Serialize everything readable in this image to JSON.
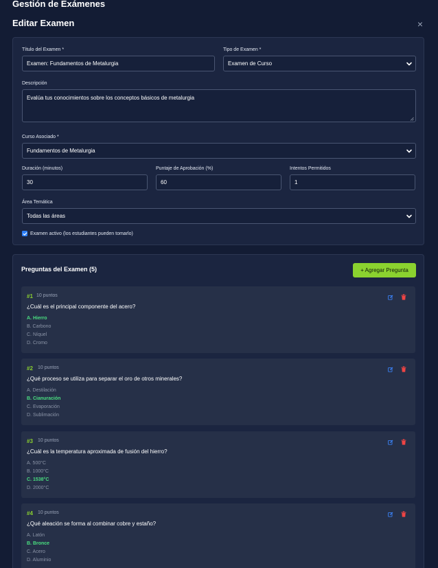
{
  "page": {
    "title": "Gestión de Exámenes"
  },
  "modal": {
    "title": "Editar Examen",
    "close_symbol": "×"
  },
  "form": {
    "title_label": "Título del Examen *",
    "title_value": "Examen: Fundamentos de Metalurgia",
    "type_label": "Tipo de Examen *",
    "type_value": "Examen de Curso",
    "description_label": "Descripción",
    "description_value": "Evalúa tus conocimientos sobre los conceptos básicos de metalurgia",
    "course_label": "Curso Asociado *",
    "course_value": "Fundamentos de Metalurgia",
    "duration_label": "Duración (minutos)",
    "duration_value": "30",
    "passing_label": "Puntaje de Aprobación (%)",
    "passing_value": "60",
    "attempts_label": "Intentos Permitidos",
    "attempts_value": "1",
    "area_label": "Área Temática",
    "area_value": "Todas las áreas",
    "active_label": "Examen activo (los estudiantes pueden tomarlo)",
    "active_checked": true
  },
  "questions_section": {
    "header": "Preguntas del Examen (5)",
    "add_button": "+ Agregar Pregunta",
    "questions": [
      {
        "number": "#1",
        "points": "10 puntos",
        "text": "¿Cuál es el principal componente del acero?",
        "options": [
          "A. Hierro",
          "B. Carbono",
          "C. Níquel",
          "D. Cromo"
        ],
        "correct_index": 0
      },
      {
        "number": "#2",
        "points": "10 puntos",
        "text": "¿Qué proceso se utiliza para separar el oro de otros minerales?",
        "options": [
          "A. Destilación",
          "B. Cianuración",
          "C. Evaporación",
          "D. Sublimación"
        ],
        "correct_index": 1
      },
      {
        "number": "#3",
        "points": "10 puntos",
        "text": "¿Cuál es la temperatura aproximada de fusión del hierro?",
        "options": [
          "A. 500°C",
          "B. 1000°C",
          "C. 1538°C",
          "D. 2000°C"
        ],
        "correct_index": 2
      },
      {
        "number": "#4",
        "points": "10 puntos",
        "text": "¿Qué aleación se forma al combinar cobre y estaño?",
        "options": [
          "A. Latón",
          "B. Bronce",
          "C. Acero",
          "D. Aluminio"
        ],
        "correct_index": 1
      }
    ]
  },
  "colors": {
    "background": "#131c34",
    "card": "#1b2540",
    "accent_green": "#8bd22f",
    "correct_green": "#4ade80",
    "edit_blue": "#3b82f6",
    "delete_red": "#ef4444"
  }
}
